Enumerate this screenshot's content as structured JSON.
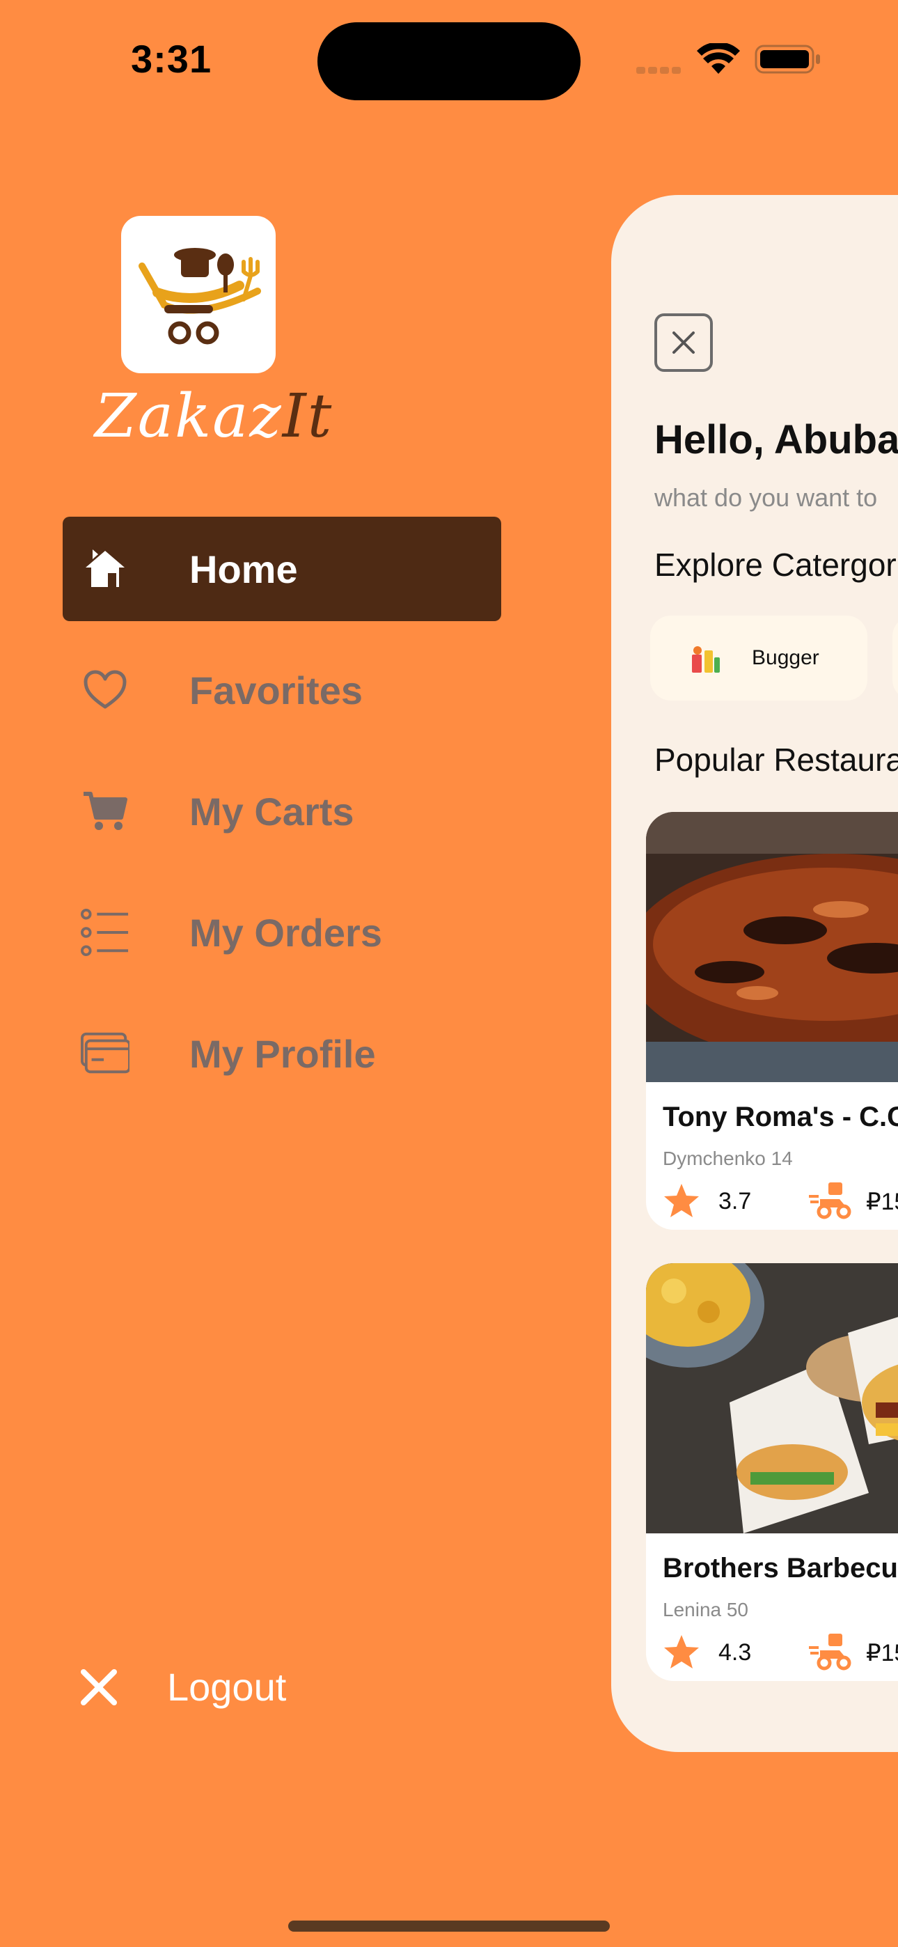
{
  "status_bar": {
    "time": "3:31"
  },
  "brand": {
    "name_part1": "Zakaz",
    "name_part2": "It"
  },
  "menu": {
    "items": [
      {
        "label": "Home",
        "icon": "home-icon",
        "active": true
      },
      {
        "label": "Favorites",
        "icon": "heart-icon",
        "active": false
      },
      {
        "label": "My Carts",
        "icon": "cart-icon",
        "active": false
      },
      {
        "label": "My Orders",
        "icon": "list-icon",
        "active": false
      },
      {
        "label": "My Profile",
        "icon": "card-icon",
        "active": false
      }
    ],
    "logout_label": "Logout"
  },
  "main": {
    "greeting": "Hello, Abuba",
    "subtitle": "what do you want to",
    "explore_title": "Explore Catergor",
    "category": {
      "label": "Bugger"
    },
    "popular_title": "Popular Restaura",
    "restaurants": [
      {
        "name": "Tony Roma's - C.C",
        "address": "Dymchenko 14",
        "rating": "3.7",
        "price": "₽15"
      },
      {
        "name": "Brothers Barbecu",
        "address": "Lenina 50",
        "rating": "4.3",
        "price": "₽15"
      }
    ]
  },
  "colors": {
    "background": "#FF8C42",
    "active_item": "#4E2A14",
    "panel": "#FAF0E6",
    "inactive_text": "#7A6A66"
  }
}
